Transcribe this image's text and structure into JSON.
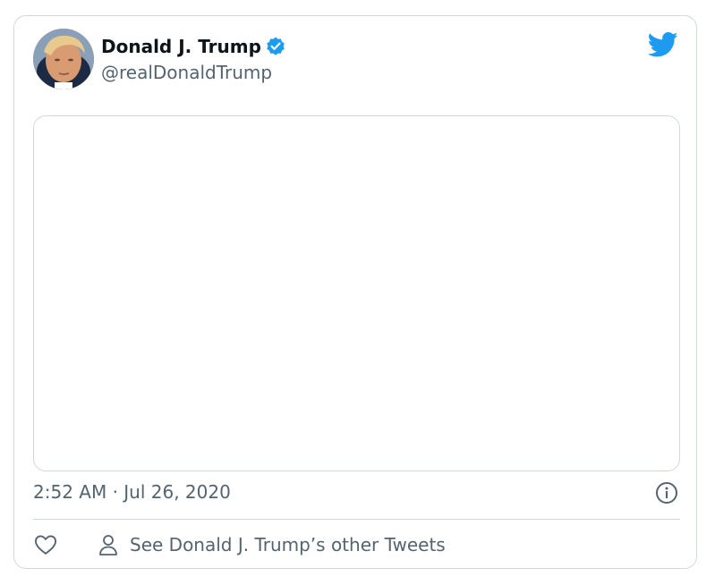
{
  "tweet": {
    "author": {
      "display_name": "Donald J. Trump",
      "handle": "@realDonaldTrump",
      "verified": true,
      "avatar_icon": "profile-photo"
    },
    "timestamp": "2:52 AM · Jul 26, 2020",
    "see_other_tweets_label": "See Donald J. Trump’s other Tweets"
  },
  "icons": {
    "brand": "twitter-bird-icon",
    "verified": "verified-badge-icon",
    "info": "info-icon",
    "like": "heart-icon",
    "profile": "person-icon"
  },
  "colors": {
    "brand_blue": "#1d9bf0",
    "text_primary": "#0f1419",
    "text_secondary": "#536471",
    "border": "#cfd9de"
  }
}
